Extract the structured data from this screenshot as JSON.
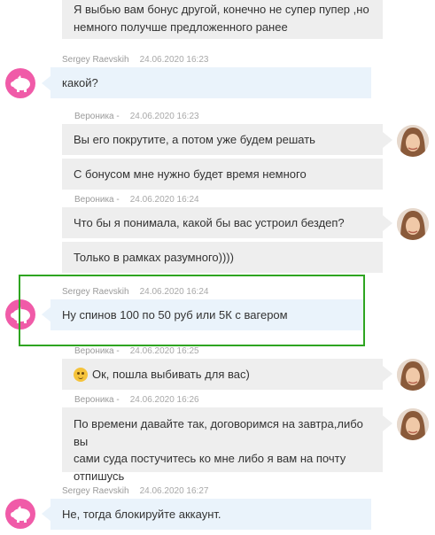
{
  "messages": [
    {
      "lines": [
        "Я выбью вам бонус другой, конечно не супер пупер ,но",
        "немного получше предложенного ранее"
      ]
    },
    {
      "sender": "Sergey Raevskih",
      "time": "24.06.2020 16:23",
      "text": "какой?"
    },
    {
      "sender": "Вероника -",
      "time": "24.06.2020 16:23",
      "text": "Вы его покрутите, а потом уже будем решать"
    },
    {
      "text": "С бонусом мне нужно будет время немного"
    },
    {
      "sender": "Вероника -",
      "time": "24.06.2020 16:24",
      "text": "Что бы я понимала, какой бы вас устроил бездеп?"
    },
    {
      "text": "Только в рамках разумного))))"
    },
    {
      "sender": "Sergey Raevskih",
      "time": "24.06.2020 16:24",
      "text": "Ну спинов 100 по 50 руб или 5К с вагером"
    },
    {
      "sender": "Вероника -",
      "time": "24.06.2020 16:25",
      "text": "Ок, пошла выбивать для вас)",
      "emoji": "smiling-face-emoji"
    },
    {
      "sender": "Вероника -",
      "time": "24.06.2020 16:26",
      "lines": [
        "По времени давайте так, договоримся на завтра,либо вы",
        "сами суда постучитесь ко мне либо я вам на почту",
        "отпишусь"
      ]
    },
    {
      "sender": "Sergey Raevskih",
      "time": "24.06.2020 16:27",
      "text": "Не, тогда блокируйте аккаунт."
    }
  ],
  "colors": {
    "incoming_bubble": "#eaf3fb",
    "outgoing_bubble": "#eeeeee",
    "user_avatar": "#f05ba8",
    "highlight": "#2ea521"
  },
  "icons": {
    "user_avatar": "pig-icon",
    "operator_avatar": "operator-photo"
  }
}
